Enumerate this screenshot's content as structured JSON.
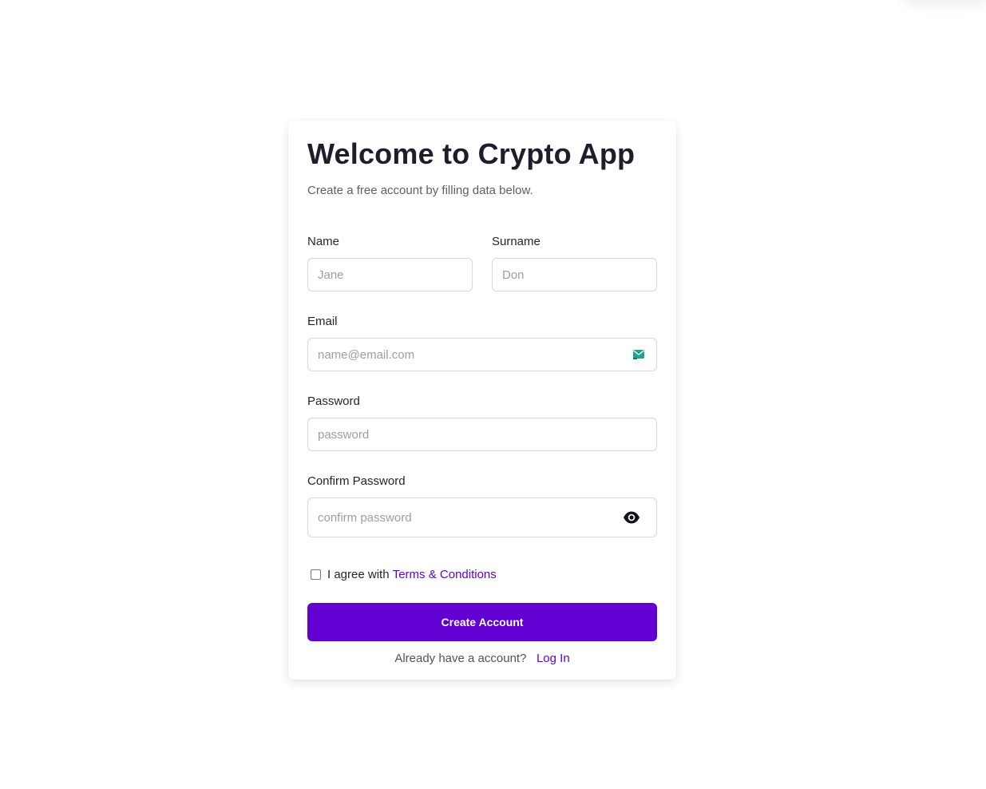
{
  "form": {
    "title": "Welcome to Crypto App",
    "subtitle": "Create a free account by filling data below.",
    "name": {
      "label": "Name",
      "placeholder": "Jane"
    },
    "surname": {
      "label": "Surname",
      "placeholder": "Don"
    },
    "email": {
      "label": "Email",
      "placeholder": "name@email.com",
      "icon": "email-icon"
    },
    "password": {
      "label": "Password",
      "placeholder": "password"
    },
    "confirm_password": {
      "label": "Confirm Password",
      "placeholder": "confirm password",
      "icon": "eye-icon"
    },
    "agree": {
      "prefix": "I agree with",
      "link": "Terms & Conditions",
      "checked": false
    },
    "submit_label": "Create Account",
    "footer": {
      "prompt": "Already have a account?",
      "link": "Log In"
    }
  },
  "colors": {
    "accent": "#6200d4",
    "text": "#1c1f2b",
    "muted": "#5b5f6b",
    "border": "#d7d9e0",
    "email_icon": "#1fa58d"
  }
}
